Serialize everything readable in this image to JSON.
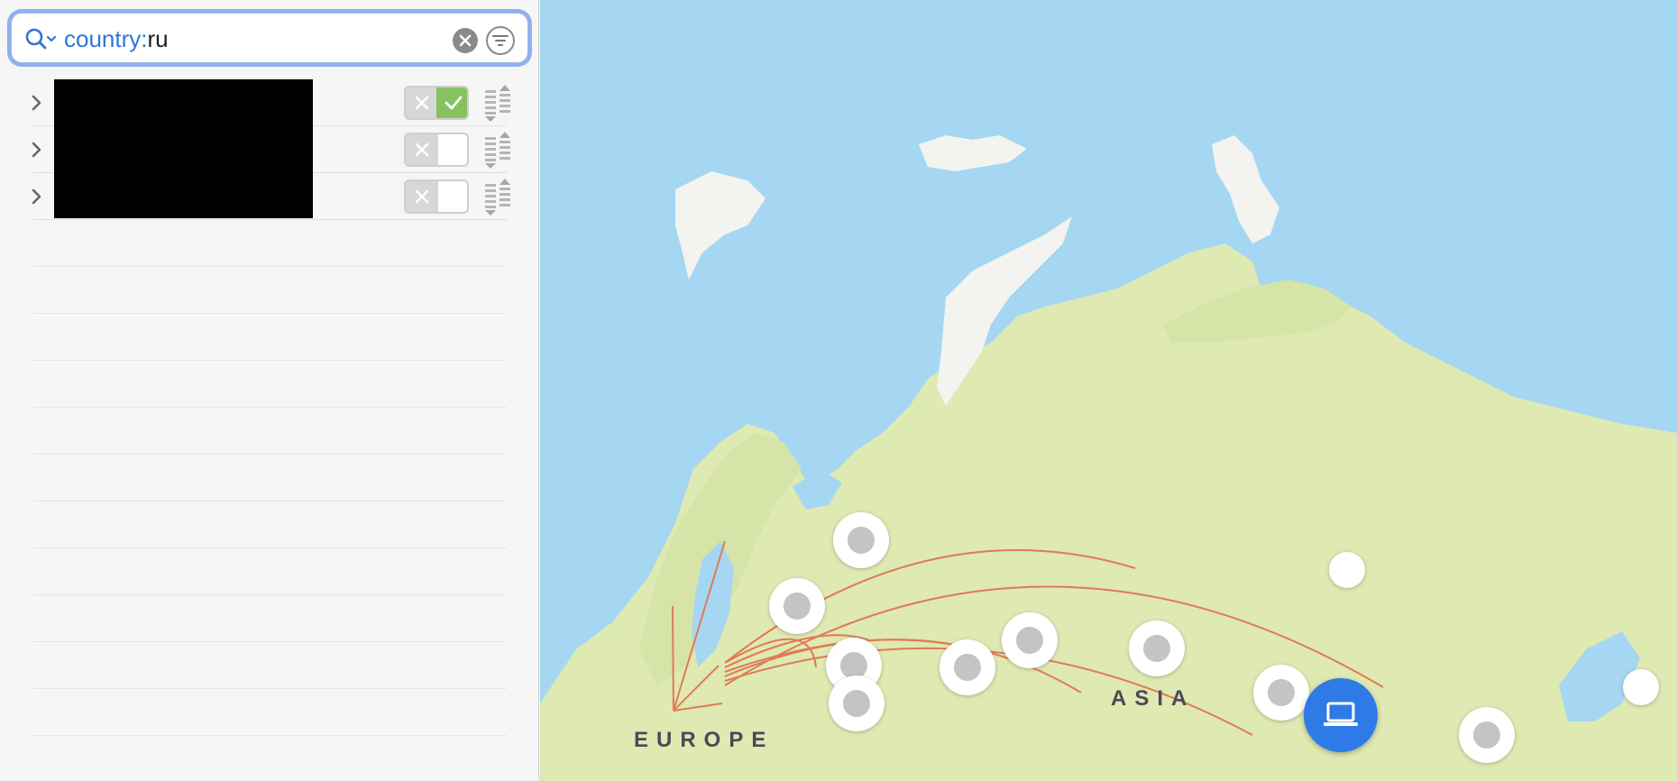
{
  "search": {
    "token": "country:",
    "value": "ru"
  },
  "icons": {
    "search": "search-icon",
    "clear": "clear-icon",
    "filter": "filter-icon",
    "expand": "chevron-right-icon",
    "toggle_off": "x-icon",
    "toggle_on": "checkmark-icon",
    "priority": "priority-icon",
    "device": "laptop-icon"
  },
  "rows": [
    {
      "name": "",
      "enabled": true
    },
    {
      "name": "",
      "enabled": false
    },
    {
      "name": "",
      "enabled": false
    }
  ],
  "map": {
    "labels": {
      "europe": "EUROPE",
      "asia": "ASIA"
    }
  },
  "colors": {
    "accent": "#2e7ae6",
    "toggle_on": "#86c35f",
    "route": "#e07a55",
    "water": "#a5d7f3",
    "land": "#dfe9b2"
  }
}
